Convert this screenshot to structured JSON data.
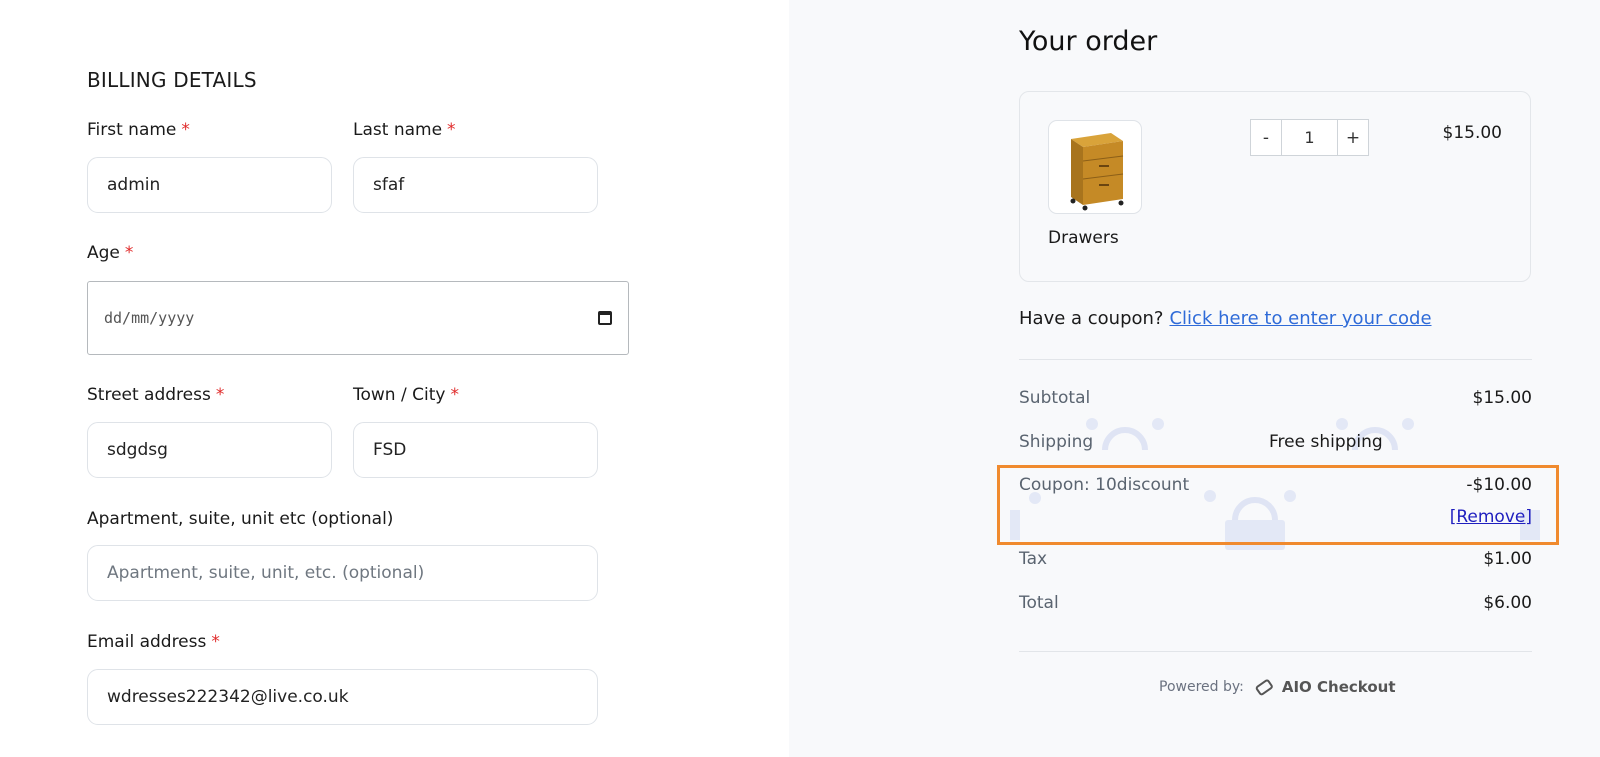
{
  "billing": {
    "section_title": "BILLING DETAILS",
    "required_mark": "*",
    "first_name": {
      "label": "First name",
      "value": "admin"
    },
    "last_name": {
      "label": "Last name",
      "value": "sfaf"
    },
    "age": {
      "label": "Age",
      "placeholder": "dd/mm/yyyy"
    },
    "street_address": {
      "label": "Street address",
      "value": "sdgdsg"
    },
    "town_city": {
      "label": "Town / City",
      "value": "FSD"
    },
    "apartment": {
      "label": "Apartment, suite, unit etc (optional)",
      "placeholder": "Apartment, suite, unit, etc. (optional)"
    },
    "email": {
      "label": "Email address",
      "value": "wdresses222342@live.co.uk"
    }
  },
  "order": {
    "title": "Your order",
    "item": {
      "name": "Drawers",
      "quantity": "1",
      "decrement_label": "-",
      "increment_label": "+",
      "price": "$15.00"
    },
    "coupon_prompt": "Have a coupon?",
    "coupon_link": "Click here to enter your code",
    "summary": {
      "subtotal_label": "Subtotal",
      "subtotal_value": "$15.00",
      "shipping_label": "Shipping",
      "shipping_value": "Free shipping",
      "coupon_label": "Coupon: 10discount",
      "coupon_value": "-$10.00",
      "remove_label": "[Remove]",
      "tax_label": "Tax",
      "tax_value": "$1.00",
      "total_label": "Total",
      "total_value": "$6.00"
    },
    "powered_by_label": "Powered by:",
    "powered_by_brand": "AIO Checkout"
  },
  "colors": {
    "required": "#e02b2b",
    "link": "#2f6bd8",
    "highlight_border": "#f08a2e",
    "right_panel_bg": "#f8f9fb"
  },
  "icons": [
    "calendar-icon",
    "drawers-product-image",
    "aio-checkout-logo-icon"
  ]
}
